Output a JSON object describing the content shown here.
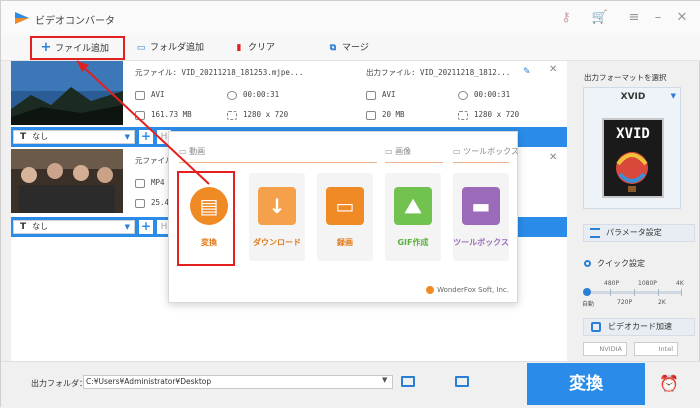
{
  "app": {
    "title": "ビデオコンバータ"
  },
  "toolbar": {
    "add_file": "ファイル追加",
    "add_folder": "フォルダ追加",
    "clear": "クリア",
    "merge": "マージ"
  },
  "files": [
    {
      "src_name": "元ファイル: VID_20211218_181253.mjpe...",
      "src_format": "AVI",
      "src_duration": "00:00:31",
      "src_size": "161.73 MB",
      "src_resolution": "1280 x 720",
      "dst_name": "出力ファイル: VID_20211218_1812...",
      "dst_format": "AVI",
      "dst_duration": "00:00:31",
      "dst_size": "20 MB",
      "dst_resolution": "1280 x 720",
      "subtitle": "なし"
    },
    {
      "src_name": "元ファイル",
      "src_format": "MP4",
      "src_size": "25.4",
      "subtitle": "なし"
    }
  ],
  "popup": {
    "cat_video": "動画",
    "cat_image": "画像",
    "cat_toolbox": "ツールボックス",
    "tiles": [
      "変換",
      "ダウンロード",
      "録画",
      "GIF作成",
      "ツールボックス"
    ],
    "brand": "WonderFox Soft, Inc."
  },
  "right_panel": {
    "select_format": "出力フォーマットを選択",
    "format_name": "XVID",
    "format_card": "XVID",
    "params": "パラメータ設定",
    "quick": "クイック設定",
    "q_480": "480P",
    "q_1080": "1080P",
    "q_4k": "4K",
    "q_auto": "自動",
    "q_720": "720P",
    "q_2k": "2K",
    "gpu": "ビデオカード加速",
    "nvidia": "NVIDIA",
    "intel": "Intel"
  },
  "bottom": {
    "output_label": "出力フォルダ：",
    "output_path": "C:¥Users¥Administrator¥Desktop",
    "convert": "変換"
  },
  "colors": {
    "accent": "#2a8ce8",
    "highlight": "#e32020",
    "convert_tile": "#f08a24",
    "download_tile": "#f5a04a",
    "record_tile": "#f08a24",
    "gif_tile": "#72c250",
    "toolbox_tile": "#9b6ab8"
  }
}
